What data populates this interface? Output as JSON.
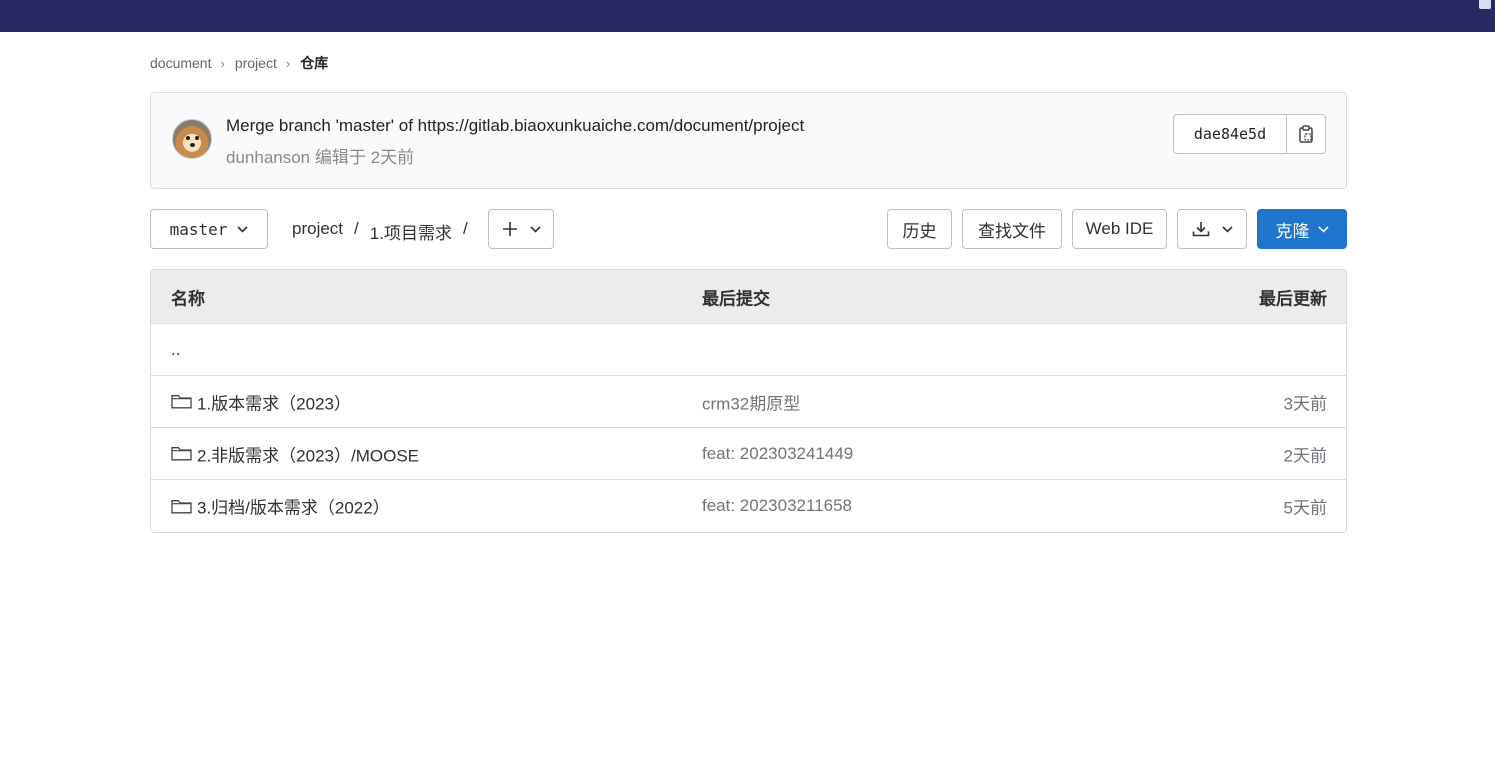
{
  "breadcrumb": {
    "items": [
      "document",
      "project"
    ],
    "current": "仓库"
  },
  "commit": {
    "title": "Merge branch 'master' of https://gitlab.biaoxunkuaiche.com/document/project",
    "author": "dunhanson",
    "edited_label": "编辑于",
    "time": "2天前",
    "sha": "dae84e5d"
  },
  "toolbar": {
    "branch": "master",
    "path": [
      "project",
      "1.项目需求"
    ],
    "history_label": "历史",
    "find_file_label": "查找文件",
    "web_ide_label": "Web IDE",
    "clone_label": "克隆"
  },
  "tree": {
    "headers": {
      "name": "名称",
      "last_commit": "最后提交",
      "last_update": "最后更新"
    },
    "parent_dir": "..",
    "rows": [
      {
        "name": "1.版本需求（2023）",
        "commit": "crm32期原型",
        "updated": "3天前"
      },
      {
        "name": "2.非版需求（2023）/MOOSE",
        "commit": "feat: 202303241449",
        "updated": "2天前"
      },
      {
        "name": "3.归档/版本需求（2022）",
        "commit": "feat: 202303211658",
        "updated": "5天前"
      }
    ]
  },
  "colors": {
    "topbar": "#292961",
    "primary": "#1f75cb"
  }
}
